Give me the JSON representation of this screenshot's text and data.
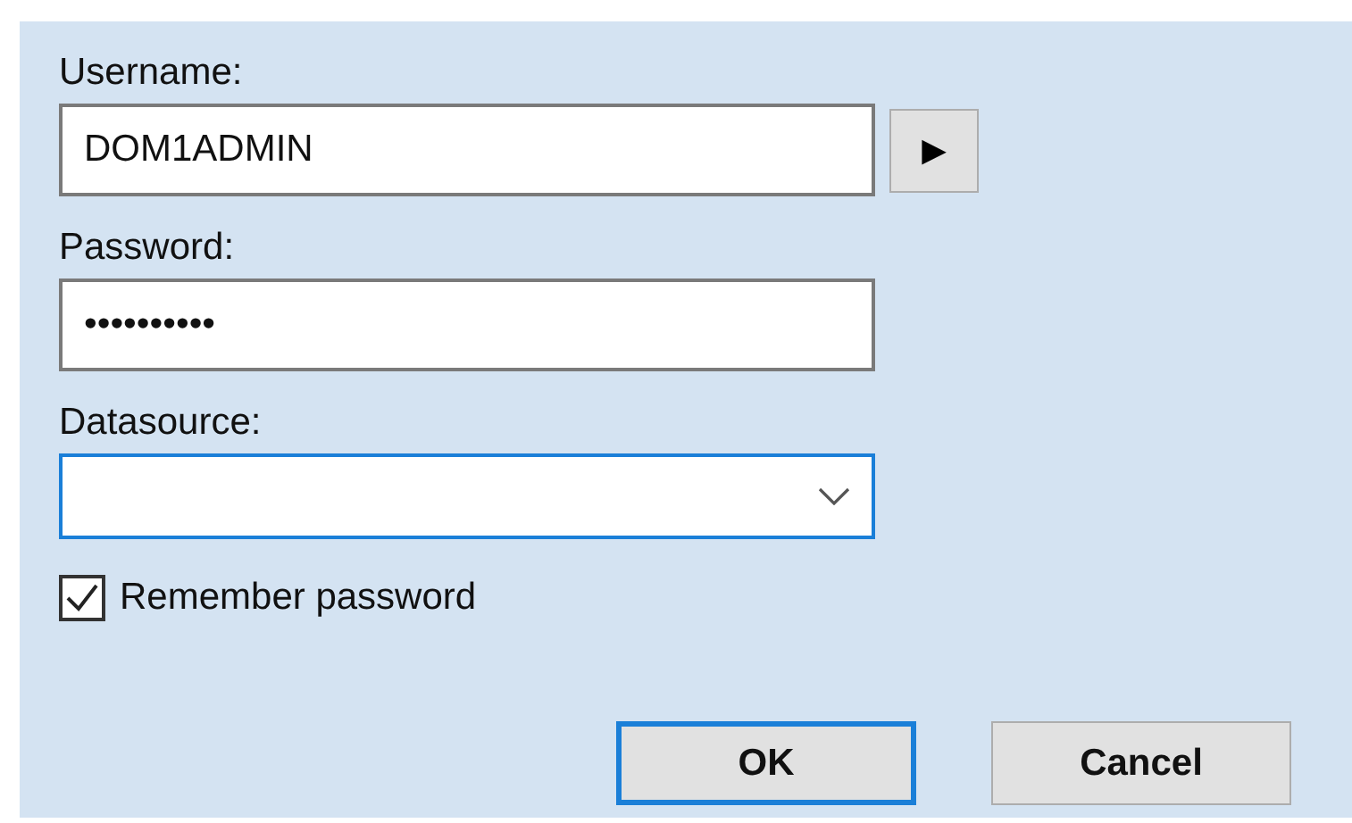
{
  "username": {
    "label": "Username:",
    "value": "DOM1ADMIN",
    "button": "▶"
  },
  "password": {
    "label": "Password:",
    "value": "••••••••••"
  },
  "datasource": {
    "label": "Datasource:",
    "focused": true
  },
  "remember": {
    "label": "Remember password",
    "checked": true
  },
  "buttons": [
    {
      "label": "OK",
      "default": true
    },
    {
      "label": "Cancel",
      "default": false
    }
  ]
}
